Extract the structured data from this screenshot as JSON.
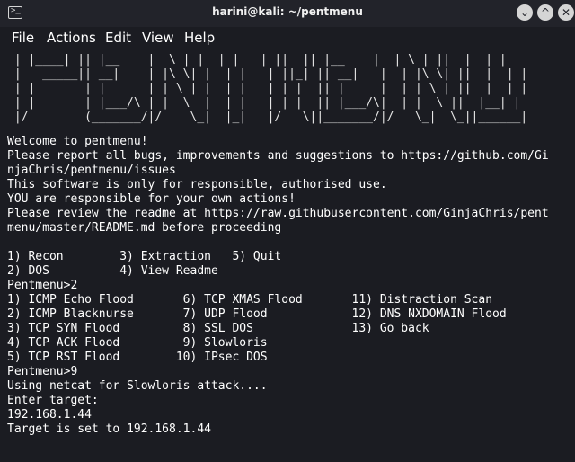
{
  "window": {
    "title": "harini@kali: ~/pentmenu",
    "buttons": {
      "minimize": "⌄",
      "maximize": "^",
      "close": "✕"
    }
  },
  "menu": {
    "file": "File",
    "actions": "Actions",
    "edit": "Edit",
    "view": "View",
    "help": "Help"
  },
  "terminal": {
    "banner": " | |____| || |__    |  \\ | |  | |   | ||  || |__    |  | \\ | ||  |  | |\n |   _____|| __|    | |\\ \\| |  | |   | ||_| || __|   |  | |\\ \\| ||  |  | |\n | |       | |      | | \\ | |  | |   | | |  || |     |  | | \\ | ||  |  | |\n | |       | |___/\\ | |  \\  |  | |   | | |  || |___/\\|  | |  \\ ||  |__| |\n |/        (_______/|/    \\_|  |_|   |/   \\||_______/|/   \\_|  \\_||______|",
    "lines": [
      "Welcome to pentmenu!",
      "Please report all bugs, improvements and suggestions to https://github.com/Gi",
      "njaChris/pentmenu/issues",
      "This software is only for responsible, authorised use.",
      "YOU are responsible for your own actions!",
      "Please review the readme at https://raw.githubusercontent.com/GinjaChris/pent",
      "menu/master/README.md before proceeding",
      "",
      "1) Recon        3) Extraction   5) Quit",
      "2) DOS          4) View Readme",
      "Pentmenu>2",
      "1) ICMP Echo Flood       6) TCP XMAS Flood       11) Distraction Scan",
      "2) ICMP Blacknurse       7) UDP Flood            12) DNS NXDOMAIN Flood",
      "3) TCP SYN Flood         8) SSL DOS              13) Go back",
      "4) TCP ACK Flood         9) Slowloris",
      "5) TCP RST Flood        10) IPsec DOS",
      "Pentmenu>9",
      "Using netcat for Slowloris attack....",
      "Enter target:",
      "192.168.1.44",
      "Target is set to 192.168.1.44"
    ]
  }
}
